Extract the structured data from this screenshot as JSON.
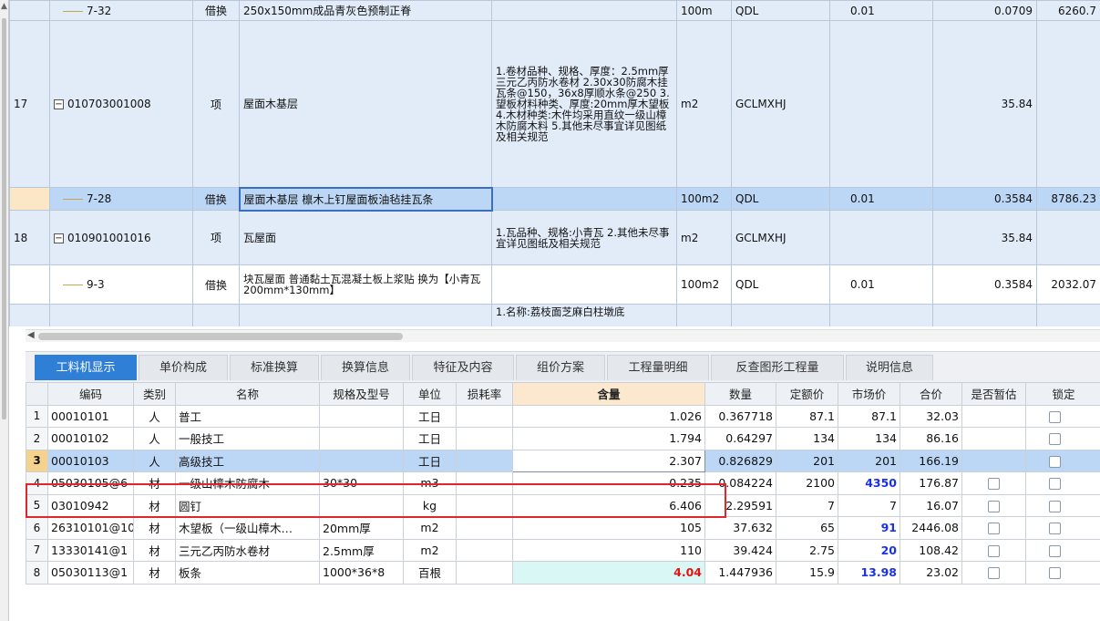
{
  "upper_rows": [
    {
      "rowno": "",
      "code": "7-32",
      "type": "借换",
      "name": "250x150mm成品青灰色预制正脊",
      "features": "",
      "unit": "100m",
      "expr": "QDL",
      "ratio": "0.01",
      "qty": "0.0709",
      "price": "6260.7"
    },
    {
      "rowno": "17",
      "code": "010703001008",
      "type": "项",
      "name": "屋面木基层",
      "features": "1.卷材品种、规格、厚度：2.5mm厚三元乙丙防水卷材 2.30x30防腐木挂瓦条@150，36x8厚顺水条@250 3.望板材料种类、厚度:20mm厚木望板 4.木材种类:木件均采用直纹一级山樟木防腐木料 5.其他未尽事宜详见图纸及相关规范",
      "unit": "m2",
      "expr": "GCLMXHJ",
      "ratio": "",
      "qty": "35.84",
      "price": ""
    },
    {
      "rowno": "",
      "code": "7-28",
      "type": "借换",
      "name": "屋面木基层 檩木上钉屋面板油毡挂瓦条",
      "features": "",
      "unit": "100m2",
      "expr": "QDL",
      "ratio": "0.01",
      "qty": "0.3584",
      "price": "8786.23"
    },
    {
      "rowno": "18",
      "code": "010901001016",
      "type": "项",
      "name": "瓦屋面",
      "features": "1.瓦品种、规格:小青瓦 2.其他未尽事宜详见图纸及相关规范",
      "unit": "m2",
      "expr": "GCLMXHJ",
      "ratio": "",
      "qty": "35.84",
      "price": ""
    },
    {
      "rowno": "",
      "code": "9-3",
      "type": "借换",
      "name": "块瓦屋面 普通黏土瓦混凝土板上浆贴 换为【小青瓦200mm*130mm】",
      "features": "",
      "unit": "100m2",
      "expr": "QDL",
      "ratio": "0.01",
      "qty": "0.3584",
      "price": "2032.07"
    },
    {
      "rowno": "",
      "code": "",
      "type": "",
      "name": "",
      "features": "1.名称:荔枝面芝麻白柱墩底",
      "unit": "",
      "expr": "",
      "ratio": "",
      "qty": "",
      "price": ""
    }
  ],
  "tabs": [
    "工料机显示",
    "单价构成",
    "标准换算",
    "换算信息",
    "特征及内容",
    "组价方案",
    "工程量明细",
    "反查图形工程量",
    "说明信息"
  ],
  "headers": [
    "编码",
    "类别",
    "名称",
    "规格及型号",
    "单位",
    "损耗率",
    "含量",
    "数量",
    "定额价",
    "市场价",
    "合价",
    "是否暂估",
    "锁定"
  ],
  "lower_rows": [
    {
      "n": "1",
      "code": "00010101",
      "cat": "人",
      "name": "普工",
      "spec": "",
      "unit": "工日",
      "loss": "",
      "qty": "1.026",
      "amount": "0.367718",
      "quota": "87.1",
      "market": "87.1",
      "total": "32.03"
    },
    {
      "n": "2",
      "code": "00010102",
      "cat": "人",
      "name": "一般技工",
      "spec": "",
      "unit": "工日",
      "loss": "",
      "qty": "1.794",
      "amount": "0.64297",
      "quota": "134",
      "market": "134",
      "total": "86.16"
    },
    {
      "n": "3",
      "code": "00010103",
      "cat": "人",
      "name": "高级技工",
      "spec": "",
      "unit": "工日",
      "loss": "",
      "qty": "2.307",
      "amount": "0.826829",
      "quota": "201",
      "market": "201",
      "total": "166.19"
    },
    {
      "n": "4",
      "code": "05030105@6",
      "cat": "材",
      "name": "一级山樟木防腐木",
      "spec": "30*30",
      "unit": "m3",
      "loss": "",
      "qty": "0.235",
      "amount": "0.084224",
      "quota": "2100",
      "market": "4350",
      "total": "176.87"
    },
    {
      "n": "5",
      "code": "03010942",
      "cat": "材",
      "name": "圆钉",
      "spec": "",
      "unit": "kg",
      "loss": "",
      "qty": "6.406",
      "amount": "2.29591",
      "quota": "7",
      "market": "7",
      "total": "16.07"
    },
    {
      "n": "6",
      "code": "26310101@10",
      "cat": "材",
      "name": "木望板（一级山樟木…",
      "spec": "20mm厚",
      "unit": "m2",
      "loss": "",
      "qty": "105",
      "amount": "37.632",
      "quota": "65",
      "market": "91",
      "total": "2446.08"
    },
    {
      "n": "7",
      "code": "13330141@1",
      "cat": "材",
      "name": "三元乙丙防水卷材",
      "spec": "2.5mm厚",
      "unit": "m2",
      "loss": "",
      "qty": "110",
      "amount": "39.424",
      "quota": "2.75",
      "market": "20",
      "total": "108.42"
    },
    {
      "n": "8",
      "code": "05030113@1",
      "cat": "材",
      "name": "板条",
      "spec": "1000*36*8",
      "unit": "百根",
      "loss": "",
      "qty": "4.04",
      "amount": "1.447936",
      "quota": "15.9",
      "market": "13.98",
      "total": "23.02"
    }
  ],
  "colors": {
    "accent": "#2f7fd6",
    "highlight_box": "#e0262a",
    "market_blue": "#1a32e0",
    "qty_red": "#e01414"
  }
}
